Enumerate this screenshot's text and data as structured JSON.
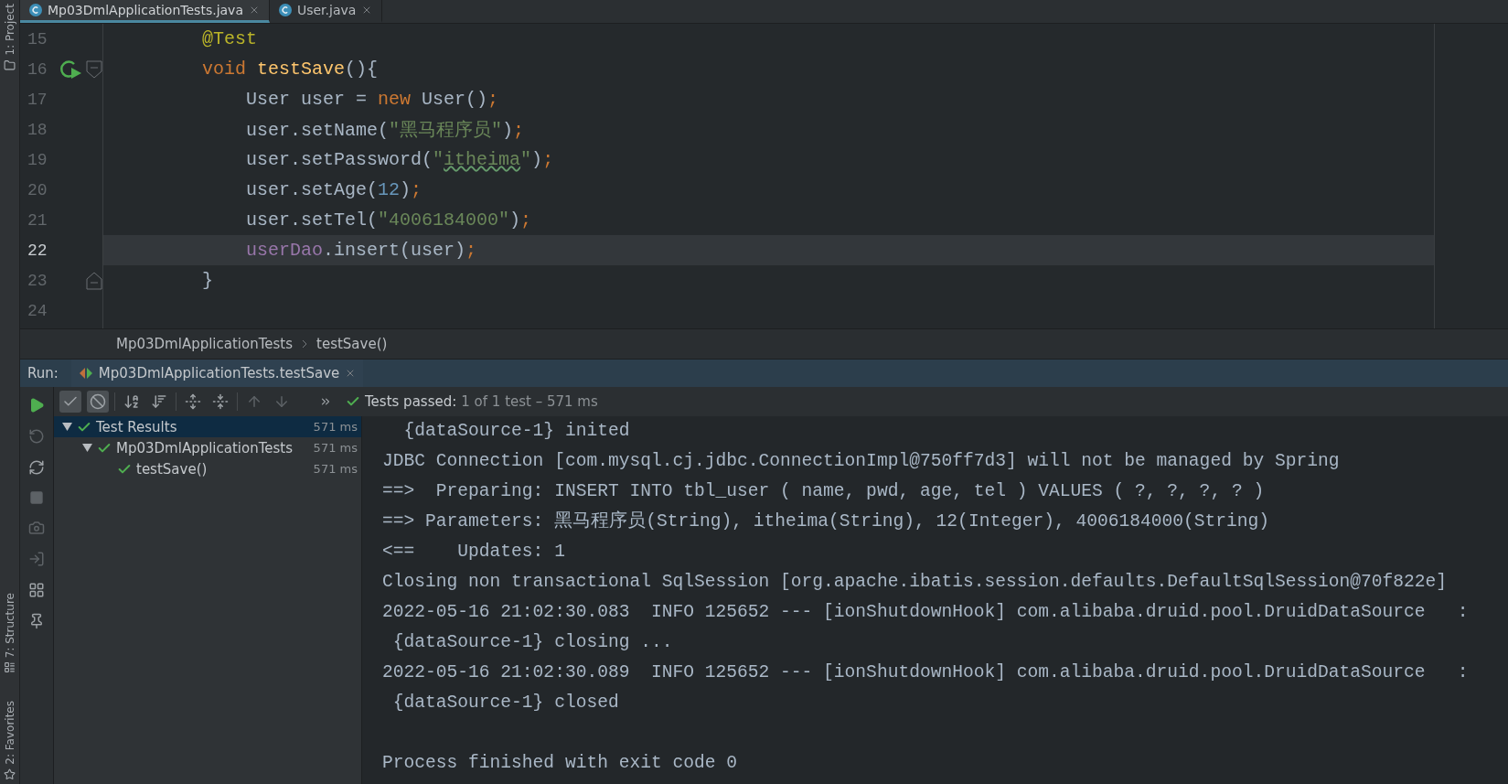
{
  "side_tools": {
    "top": [
      {
        "label": "1: Project"
      }
    ],
    "bottom": [
      {
        "label": "7: Structure"
      },
      {
        "label": "2: Favorites"
      }
    ]
  },
  "tabs": [
    {
      "label": "Mp03DmlApplicationTests.java",
      "selected": true
    },
    {
      "label": "User.java",
      "selected": false
    }
  ],
  "code": {
    "lines": [
      {
        "number": "15",
        "current": false,
        "tokens": [
          {
            "kind": "annotation",
            "text": "    @Test"
          }
        ]
      },
      {
        "number": "16",
        "current": false,
        "run_button": true,
        "fold_start": true,
        "tokens": [
          {
            "kind": "keyword",
            "text": "    void "
          },
          {
            "kind": "method",
            "text": "testSave"
          },
          {
            "kind": "plain",
            "text": "(){"
          }
        ]
      },
      {
        "number": "17",
        "current": false,
        "tokens": [
          {
            "kind": "plain",
            "text": "        User user = "
          },
          {
            "kind": "keyword",
            "text": "new "
          },
          {
            "kind": "plain",
            "text": "User()"
          },
          {
            "kind": "punct",
            "text": ";"
          }
        ]
      },
      {
        "number": "18",
        "current": false,
        "tokens": [
          {
            "kind": "plain",
            "text": "        user.setName("
          },
          {
            "kind": "string",
            "text": "\"黑马程序员\""
          },
          {
            "kind": "plain",
            "text": ")"
          },
          {
            "kind": "punct",
            "text": ";"
          }
        ]
      },
      {
        "number": "19",
        "current": false,
        "tokens": [
          {
            "kind": "plain",
            "text": "        user.setPassword("
          },
          {
            "kind": "string",
            "text": "\""
          },
          {
            "kind": "typo",
            "text": "itheima"
          },
          {
            "kind": "string",
            "text": "\""
          },
          {
            "kind": "plain",
            "text": ")"
          },
          {
            "kind": "punct",
            "text": ";"
          }
        ]
      },
      {
        "number": "20",
        "current": false,
        "tokens": [
          {
            "kind": "plain",
            "text": "        user.setAge("
          },
          {
            "kind": "number",
            "text": "12"
          },
          {
            "kind": "plain",
            "text": ")"
          },
          {
            "kind": "punct",
            "text": ";"
          }
        ]
      },
      {
        "number": "21",
        "current": false,
        "tokens": [
          {
            "kind": "plain",
            "text": "        user.setTel("
          },
          {
            "kind": "string",
            "text": "\"4006184000\""
          },
          {
            "kind": "plain",
            "text": ")"
          },
          {
            "kind": "punct",
            "text": ";"
          }
        ]
      },
      {
        "number": "22",
        "current": true,
        "tokens": [
          {
            "kind": "field",
            "text": "        userDao"
          },
          {
            "kind": "plain",
            "text": ".insert(user)"
          },
          {
            "kind": "punct",
            "text": ";"
          }
        ]
      },
      {
        "number": "23",
        "current": false,
        "fold_end": true,
        "tokens": [
          {
            "kind": "plain",
            "text": "    }"
          }
        ]
      },
      {
        "number": "24",
        "current": false
      }
    ]
  },
  "breadcrumb": [
    "Mp03DmlApplicationTests",
    "testSave()"
  ],
  "run": {
    "label": "Run:",
    "tab": "Mp03DmlApplicationTests.testSave",
    "toggles": [
      {
        "kind": "passed",
        "on": true
      },
      {
        "kind": "ignored",
        "on": true
      }
    ],
    "status": {
      "label": "Tests passed:",
      "detail": "1 of 1 test – 571 ms"
    },
    "tree": [
      {
        "label": "Test Results",
        "time": "571 ms",
        "selected": true,
        "expanded": true,
        "children": [
          {
            "label": "Mp03DmlApplicationTests",
            "time": "571 ms",
            "selected": false,
            "expanded": true,
            "children": [
              {
                "label": "testSave()",
                "time": "571 ms",
                "selected": false
              }
            ]
          }
        ]
      }
    ],
    "console": [
      {
        "text": "  {dataSource-1} inited"
      },
      {
        "text": "JDBC Connection [com.mysql.cj.jdbc.ConnectionImpl@750ff7d3] will not be managed by Spring"
      },
      {
        "text": "==>  Preparing: INSERT INTO tbl_user ( name, pwd, age, tel ) VALUES ( ?, ?, ?, ? )"
      },
      {
        "text": "==> Parameters: 黑马程序员(String), itheima(String), 12(Integer), 4006184000(String)"
      },
      {
        "text": "<==    Updates: 1"
      },
      {
        "text": "Closing non transactional SqlSession [org.apache.ibatis.session.defaults.DefaultSqlSession@70f822e]"
      },
      {
        "text": "2022-05-16 21:02:30.083  INFO 125652 --- [ionShutdownHook] com.alibaba.druid.pool.DruidDataSource   :"
      },
      {
        "text": " {dataSource-1} closing ..."
      },
      {
        "text": "2022-05-16 21:02:30.089  INFO 125652 --- [ionShutdownHook] com.alibaba.druid.pool.DruidDataSource   :"
      },
      {
        "text": " {dataSource-1} closed"
      },
      {
        "text": "Process finished with exit code 0",
        "blank_before": true
      }
    ]
  }
}
